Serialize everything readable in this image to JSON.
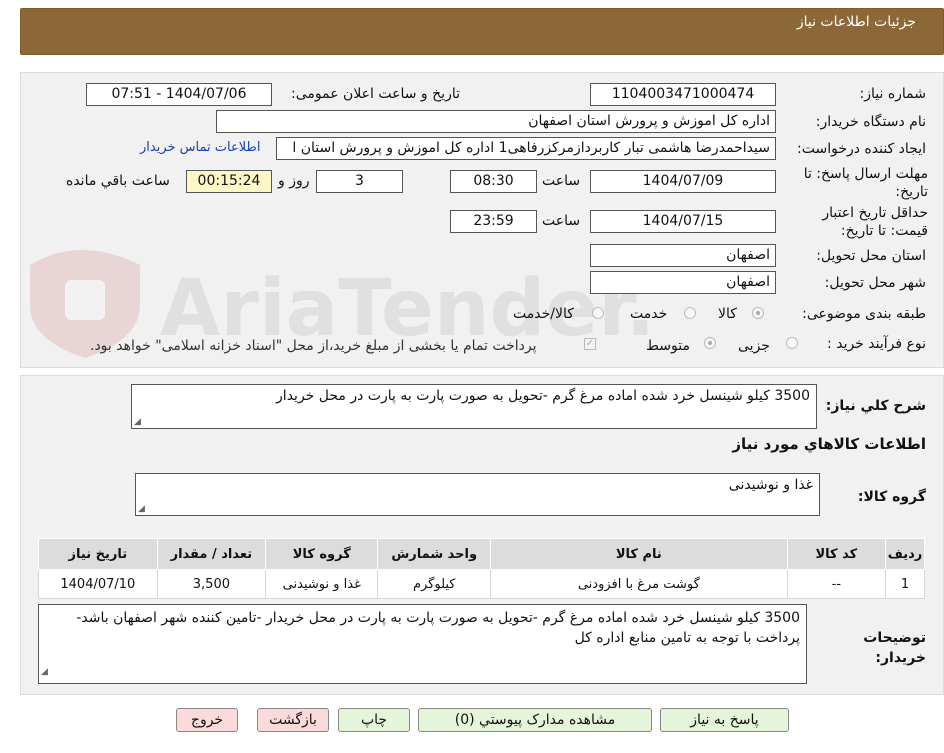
{
  "header": {
    "title": "جزئیات اطلاعات نیاز"
  },
  "form": {
    "need_number_label": "شماره نیاز:",
    "need_number": "1104003471000474",
    "announce_label": "تاریخ و ساعت اعلان عمومی:",
    "announce_value": "1404/07/06 - 07:51",
    "buyer_org_label": "نام دستگاه خریدار:",
    "buyer_org": "اداره کل اموزش و پرورش استان اصفهان",
    "requester_label": "ایجاد کننده درخواست:",
    "requester": "سیداحمدرضا هاشمی تبار کاربردازمرکزرفاهی1 اداره کل اموزش و پرورش استان ا",
    "contact_link": "اطلاعات تماس خریدار",
    "deadline_label": "مهلت ارسال پاسخ: تا تاریخ:",
    "deadline_date": "1404/07/09",
    "time_label": "ساعت",
    "deadline_time": "08:30",
    "days": "3",
    "days_label": "روز و",
    "countdown": "00:15:24",
    "remaining_label": "ساعت باقي مانده",
    "validity_label": "حداقل تاریخ اعتبار قیمت: تا تاریخ:",
    "validity_date": "1404/07/15",
    "validity_time": "23:59",
    "province_label": "استان محل تحویل:",
    "province": "اصفهان",
    "city_label": "شهر محل تحویل:",
    "city": "اصفهان",
    "category_label": "طبقه بندی موضوعی:",
    "category_options": [
      "کالا",
      "خدمت",
      "کالا/خدمت"
    ],
    "process_label": "نوع فرآیند خرید :",
    "process_options": [
      "جزیی",
      "متوسط"
    ],
    "payment_note": "پرداخت تمام یا بخشی از مبلغ خرید،از محل \"اسناد خزانه اسلامی\" خواهد بود."
  },
  "details": {
    "summary_label": "شرح کلي نياز:",
    "summary": "3500 کیلو شینسل خرد شده اماده مرغ گرم -تحویل به صورت پارت به پارت در محل خریدار",
    "goods_info_title": "اطلاعات کالاهاي مورد نياز",
    "goods_group_label": "گروه کالا:",
    "goods_group": "غذا و نوشیدنی",
    "table": {
      "headers": [
        "رديف",
        "کد کالا",
        "نام کالا",
        "واحد شمارش",
        "گروه کالا",
        "تعداد / مقدار",
        "تاریخ نیاز"
      ],
      "rows": [
        [
          "1",
          "--",
          "گوشت مرغ با افزودنی",
          "کیلوگرم",
          "غذا و نوشیدنی",
          "3,500",
          "1404/07/10"
        ]
      ]
    },
    "buyer_notes_label": "توضیحات خریدار:",
    "buyer_notes": "3500 کیلو شینسل خرد شده اماده مرغ گرم -تحویل به صورت پارت به پارت در محل خریدار -تامین کننده شهر اصفهان باشد- پرداخت با توجه به تامین منابع اداره کل"
  },
  "buttons": {
    "reply": "پاسخ به نياز",
    "attachments": "مشاهده مدارک پيوستي (0)",
    "print": "چاپ",
    "back": "بازگشت",
    "exit": "خروج"
  },
  "watermark": {
    "text": "AriaTender.neT"
  },
  "colors": {
    "header_bg": "#8c6839",
    "countdown_bg": "#fdf7c6",
    "green_btn": "#e6f5da",
    "pink_btn": "#fadadb"
  }
}
